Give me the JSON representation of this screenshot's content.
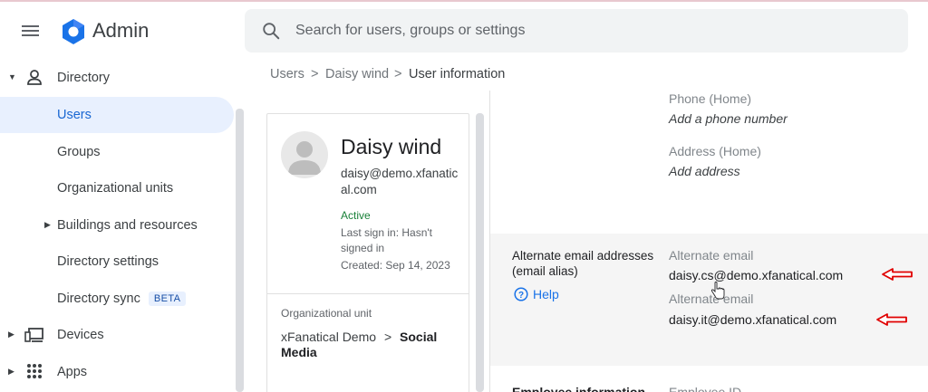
{
  "header": {
    "app_name": "Admin",
    "search_placeholder": "Search for users, groups or settings"
  },
  "sidebar": {
    "items": [
      {
        "label": "Directory"
      },
      {
        "label": "Users"
      },
      {
        "label": "Groups"
      },
      {
        "label": "Organizational units"
      },
      {
        "label": "Buildings and resources"
      },
      {
        "label": "Directory settings"
      },
      {
        "label": "Directory sync",
        "badge": "BETA"
      },
      {
        "label": "Devices"
      },
      {
        "label": "Apps"
      }
    ]
  },
  "breadcrumb": {
    "items": [
      "Users",
      "Daisy wind",
      "User information"
    ],
    "separator": ">"
  },
  "profile": {
    "name": "Daisy wind",
    "email": "daisy@demo.xfanatical.com",
    "status": "Active",
    "last_sign_in_line1": "Last sign in: Hasn't",
    "last_sign_in_line2": "signed in",
    "created": "Created: Sep 14, 2023",
    "org_unit_label": "Organizational unit",
    "org_unit_parent": "xFanatical Demo",
    "org_unit_separator": ">",
    "org_unit_child_line1": "Social",
    "org_unit_child_line2": "Media"
  },
  "details": {
    "phone_label": "Phone (Home)",
    "phone_value": "Add a phone number",
    "address_label": "Address (Home)",
    "address_value": "Add address",
    "alias_section_title": "Alternate email addresses (email alias)",
    "help_label": "Help",
    "aliases": [
      {
        "label": "Alternate email",
        "value": "daisy.cs@demo.xfanatical.com"
      },
      {
        "label": "Alternate email",
        "value": "daisy.it@demo.xfanatical.com"
      }
    ],
    "next_section_partial": "Employee information",
    "next_field_partial": "Employee ID"
  },
  "colors": {
    "accent": "#1a73e8",
    "active_nav_bg": "#e8f0fe",
    "status_active": "#188038",
    "annotation_arrow": "#e00000"
  }
}
